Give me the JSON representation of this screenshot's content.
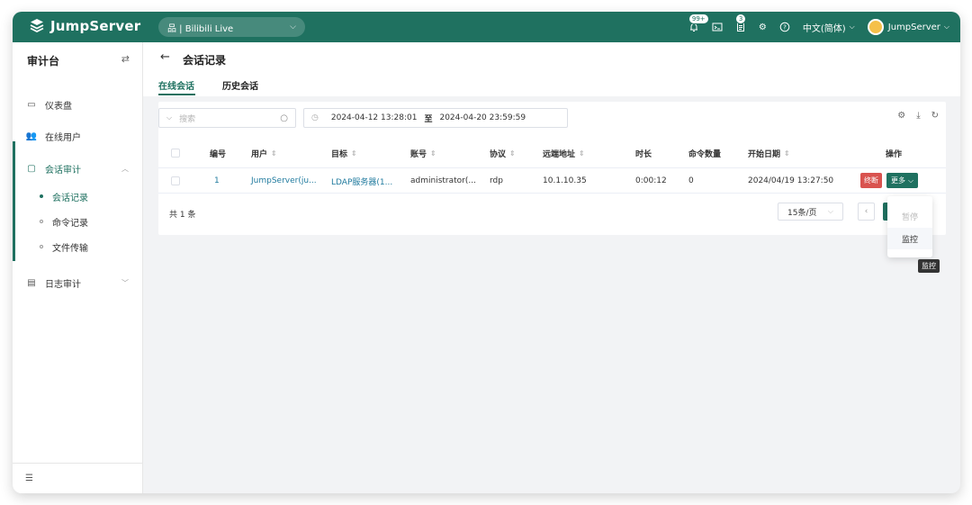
{
  "brand": {
    "name": "JumpServer",
    "accent": "#1f7160",
    "danger": "#d9534f",
    "link": "#1f7a9e"
  },
  "topbar": {
    "org": "品 | Bilibili Live",
    "notify_badge": "99+",
    "ticket_badge": "3",
    "language": "中文(简体)",
    "user": "JumpServer",
    "icons": [
      "bell-icon",
      "terminal-icon",
      "ticket-icon",
      "settings-icon",
      "help-icon"
    ]
  },
  "sidebar": {
    "title": "审计台",
    "toggle_icon": "switch-icon",
    "items": [
      {
        "label": "仪表盘",
        "icon": "dashboard-icon"
      },
      {
        "label": "在线用户",
        "icon": "users-icon"
      },
      {
        "label": "会话审计",
        "icon": "session-icon",
        "open": true
      },
      {
        "label": "日志审计",
        "icon": "log-icon"
      }
    ],
    "sub_items": [
      {
        "label": "会话记录",
        "active": true
      },
      {
        "label": "命令记录"
      },
      {
        "label": "文件传输"
      }
    ],
    "bottom_icon": "collapse-icon"
  },
  "page": {
    "title": "会话记录",
    "tabs": [
      {
        "label": "在线会话",
        "active": true
      },
      {
        "label": "历史会话"
      }
    ]
  },
  "filters": {
    "search_placeholder": "搜索",
    "date_start": "2024-04-12 13:28:01",
    "date_sep": "至",
    "date_end": "2024-04-20 23:59:59"
  },
  "table": {
    "columns": [
      "编号",
      "用户",
      "目标",
      "账号",
      "协议",
      "远端地址",
      "时长",
      "命令数量",
      "开始日期",
      "操作"
    ],
    "rows": [
      {
        "id": "1",
        "user": "JumpServer(ju...",
        "target": "LDAP服务器(1...",
        "account": "administrator(...",
        "protocol": "rdp",
        "remote_addr": "10.1.10.35",
        "duration": "0:00:12",
        "commands": "0",
        "start_date": "2024/04/19 13:27:50",
        "kill_label": "终断",
        "more_label": "更多"
      }
    ],
    "total": "共 1 条",
    "page_size": "15条/页"
  },
  "more_menu": {
    "items": [
      {
        "label": "暂停",
        "disabled": true
      },
      {
        "label": "监控"
      }
    ],
    "tooltip": "监控"
  }
}
